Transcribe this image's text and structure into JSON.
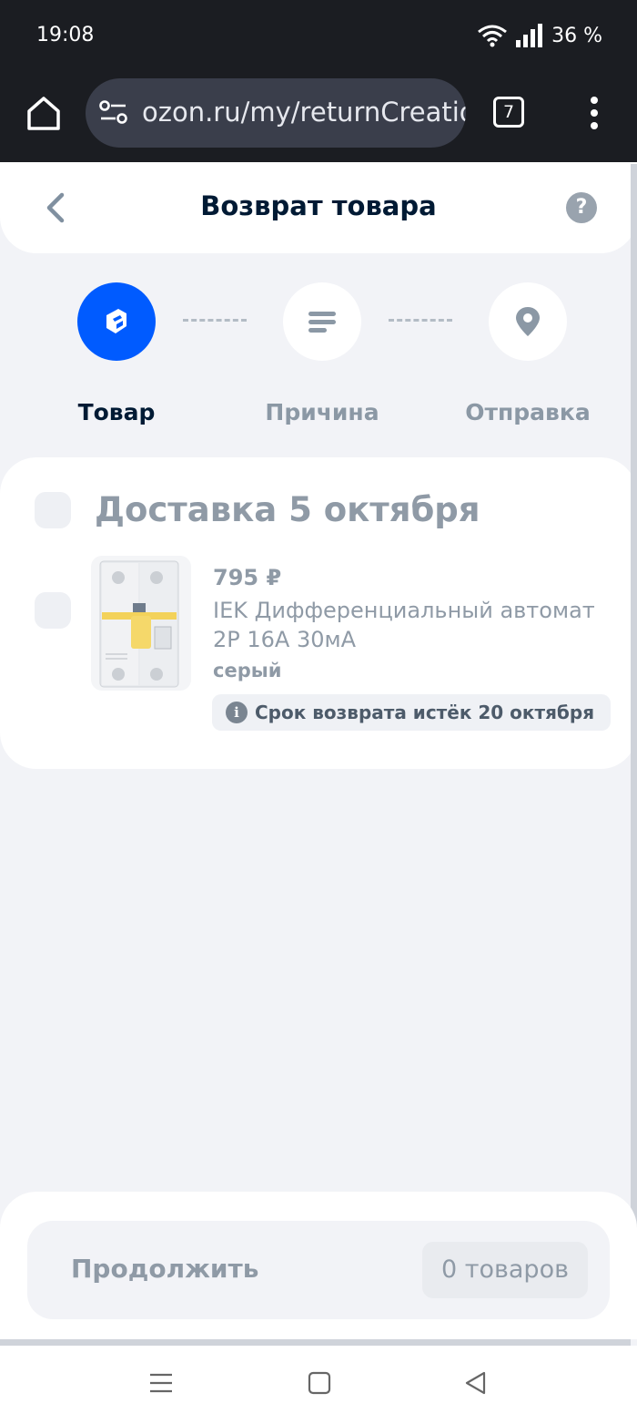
{
  "status_bar": {
    "time": "19:08",
    "battery": "36 %"
  },
  "browser": {
    "url": "ozon.ru/my/returnCreation",
    "tab_count": "7"
  },
  "header": {
    "title": "Возврат товара",
    "help": "?"
  },
  "steps": [
    {
      "label": "Товар",
      "icon": "box-icon",
      "active": true
    },
    {
      "label": "Причина",
      "icon": "list-icon",
      "active": false
    },
    {
      "label": "Отправка",
      "icon": "location-pin-icon",
      "active": false
    }
  ],
  "delivery_group": {
    "title": "Доставка 5 октября",
    "items": [
      {
        "price": "795 ₽",
        "name": "IEK Дифференциальный автомат 2P 16A 30мА",
        "color": "серый",
        "return_notice": "Срок возврата истёк 20 октября"
      }
    ]
  },
  "footer": {
    "continue_label": "Продолжить",
    "count": "0 товаров"
  },
  "colors": {
    "accent": "#005bff",
    "muted_text": "#8f9aa6",
    "background": "#f2f3f7"
  }
}
